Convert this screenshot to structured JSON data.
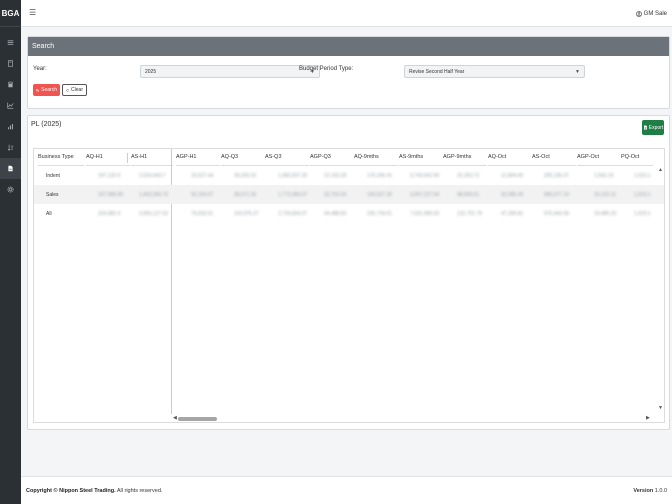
{
  "brand": "BGA",
  "topbar": {
    "menu_icon": "☰",
    "user_name": "GM Sale"
  },
  "search": {
    "header": "Search",
    "year_label": "Year:",
    "year_value": "2025",
    "budget_label": "Budget Period Type:",
    "budget_value": "Revise Second Half Year",
    "search_btn": "Search",
    "clear_btn": "Clear"
  },
  "pl": {
    "title": "PL (2025)",
    "export_btn": "Export",
    "frozen_headers": [
      "Business Type",
      "AQ-H1",
      "AS-H1"
    ],
    "scroll_headers": [
      "AGP-H1",
      "AQ-Q3",
      "AS-Q3",
      "AGP-Q3",
      "AQ-9mths",
      "AS-9mths",
      "AGP-9mths",
      "AQ-Oct",
      "AS-Oct",
      "AGP-Oct",
      "PQ-Oct"
    ],
    "rows": [
      {
        "type": "Indent",
        "frozen": [
          "197,132.9",
          "2,024,443.7"
        ],
        "values": [
          "10,527.44",
          "39,203.32",
          "1,082,597.30",
          "12,193.28",
          "176,336.41",
          "3,743,642.00",
          "22,263.72",
          "12,804.40",
          "205,195.07",
          "1,562.19",
          "1,023.1"
        ]
      },
      {
        "type": "Sales",
        "frozen": [
          "107,589.90",
          "1,403,369.75"
        ],
        "values": [
          "92,154.07",
          "38,071.36",
          "1,773,389.07",
          "32,753.34",
          "156,627.30",
          "3,007,227.54",
          "98,506.61",
          "32,085.39",
          "680,077.10",
          "16,122.11",
          "1,023.1"
        ]
      },
      {
        "type": "All",
        "frozen": [
          "224,082.4",
          "3,063,127.52"
        ],
        "values": [
          "79,532.01",
          "116,975.27",
          "2,734,604.07",
          "44,488.83",
          "235,718.61",
          "7,031,585.03",
          "122,701.79",
          "47,336.81",
          "970,443.56",
          "19,485.33",
          "1,023.1"
        ]
      }
    ]
  },
  "footer": {
    "copyright_prefix": "Copyright ©",
    "company": "Nippon Steel Trading.",
    "rights": "All rights reserved.",
    "version_label": "Version",
    "version_value": "1.0.0"
  }
}
